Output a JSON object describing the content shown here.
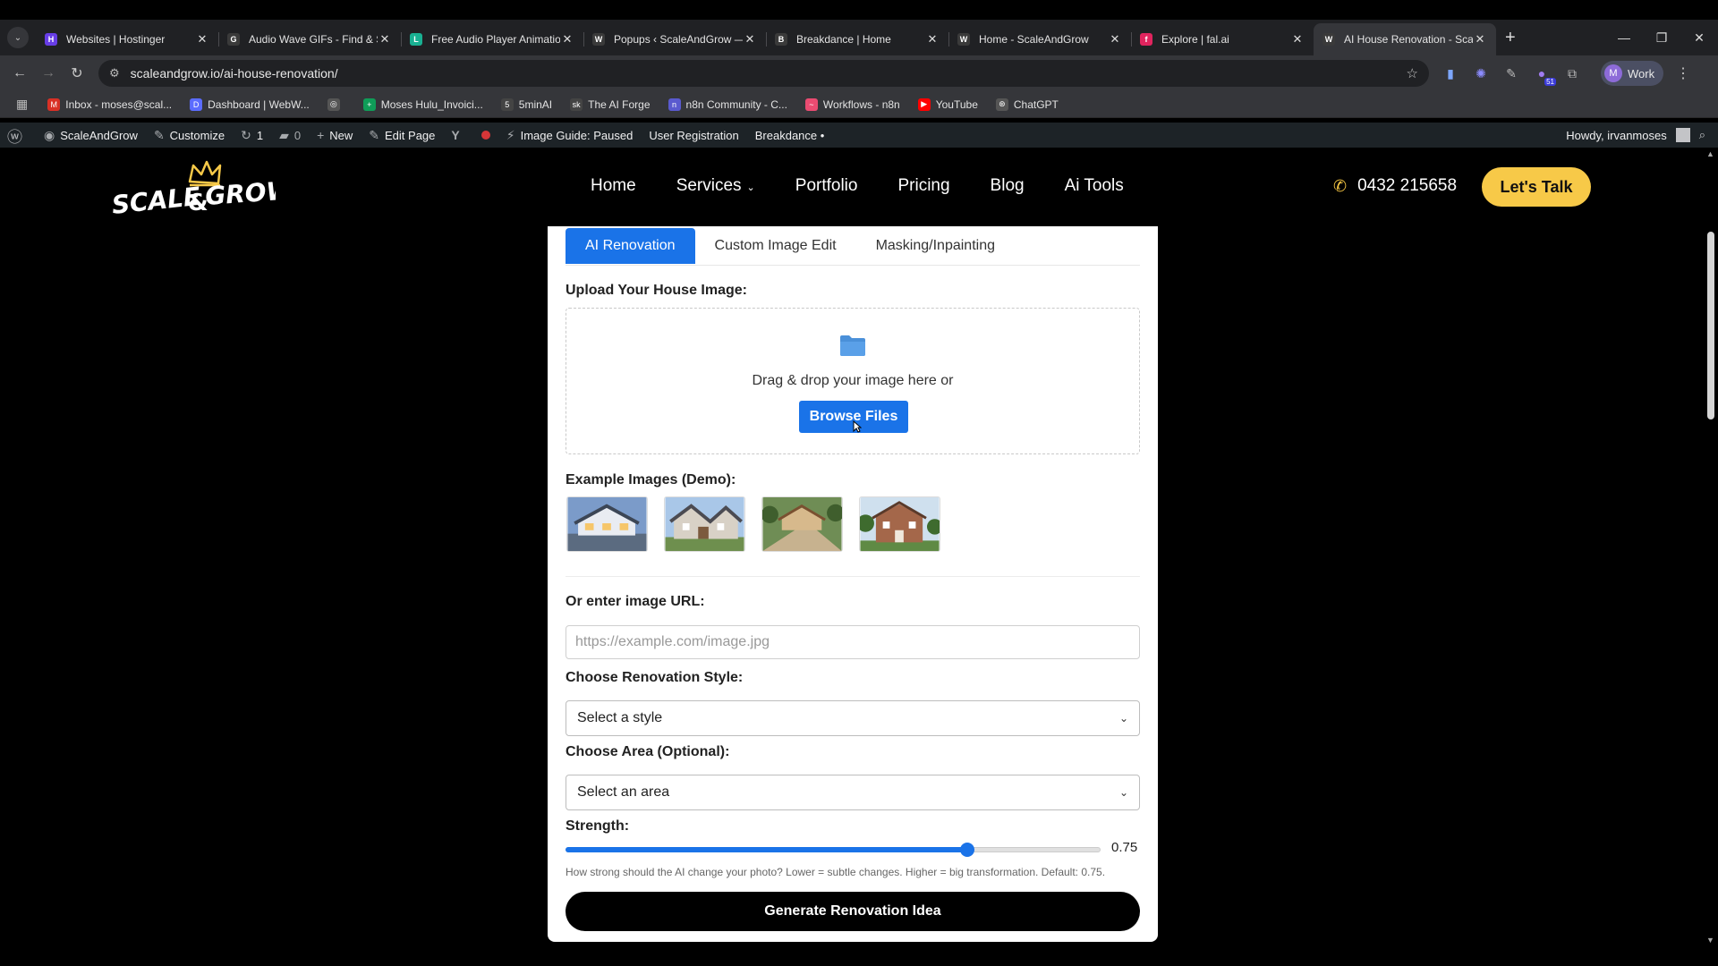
{
  "browser": {
    "tabs": [
      {
        "title": "Websites | Hostinger",
        "favicon_color": "#673de6",
        "favicon": "H"
      },
      {
        "title": "Audio Wave GIFs - Find & S",
        "favicon_color": "#3a3a3a",
        "favicon": "G"
      },
      {
        "title": "Free Audio Player Animatio",
        "favicon_color": "#19b092",
        "favicon": "L"
      },
      {
        "title": "Popups ‹ ScaleAndGrow —",
        "favicon_color": "#3a3a3a",
        "favicon": "W"
      },
      {
        "title": "Breakdance | Home",
        "favicon_color": "#3a3a3a",
        "favicon": "B"
      },
      {
        "title": "Home - ScaleAndGrow",
        "favicon_color": "#3a3a3a",
        "favicon": "W"
      },
      {
        "title": "Explore | fal.ai",
        "favicon_color": "#e0245e",
        "favicon": "f"
      },
      {
        "title": "AI House Renovation - Scal",
        "favicon_color": "#3a3a3a",
        "favicon": "W",
        "active": true
      }
    ],
    "url": "scaleandgrow.io/ai-house-renovation/",
    "profile_initial": "M",
    "profile_label": "Work",
    "extension_badge": "51",
    "bookmarks": [
      {
        "label": "Inbox - moses@scal...",
        "color": "#d93025",
        "icon": "M"
      },
      {
        "label": "Dashboard | WebW...",
        "color": "#5b6cff",
        "icon": "D"
      },
      {
        "label": "",
        "color": "#555555",
        "icon": "◎"
      },
      {
        "label": "Moses Hulu_Invoici...",
        "color": "#0f9d58",
        "icon": "+"
      },
      {
        "label": "5minAI",
        "color": "#444444",
        "icon": "5"
      },
      {
        "label": "The AI Forge",
        "color": "#444444",
        "icon": "sk"
      },
      {
        "label": "n8n Community - C...",
        "color": "#5a5acf",
        "icon": "n"
      },
      {
        "label": "Workflows - n8n",
        "color": "#ea4b71",
        "icon": "~"
      },
      {
        "label": "YouTube",
        "color": "#ff0000",
        "icon": "▶"
      },
      {
        "label": "ChatGPT",
        "color": "#555555",
        "icon": "⊛"
      }
    ]
  },
  "wpbar": {
    "site": "ScaleAndGrow",
    "customize": "Customize",
    "updates": "1",
    "comments": "0",
    "new": "New",
    "edit_page": "Edit Page",
    "image_guide": "Image Guide: Paused",
    "user_registration": "User Registration",
    "breakdance": "Breakdance •",
    "howdy": "Howdy, irvanmoses"
  },
  "site": {
    "nav": [
      "Home",
      "Services",
      "Portfolio",
      "Pricing",
      "Blog",
      "Ai Tools"
    ],
    "phone": "0432 215658",
    "cta": "Let's Talk",
    "accent": "#f7c948"
  },
  "tool": {
    "tabs": [
      "AI Renovation",
      "Custom Image Edit",
      "Masking/Inpainting"
    ],
    "upload_label": "Upload Your House Image:",
    "drop_text": "Drag & drop your image here or",
    "browse_label": "Browse Files",
    "examples_label": "Example Images (Demo):",
    "url_label": "Or enter image URL:",
    "url_placeholder": "https://example.com/image.jpg",
    "style_label": "Choose Renovation Style:",
    "style_value": "Select a style",
    "area_label": "Choose Area (Optional):",
    "area_value": "Select an area",
    "strength_label": "Strength:",
    "strength_value": 0.75,
    "strength_display": "0.75",
    "strength_hint": "How strong should the AI change your photo? Lower = subtle changes. Higher = big transformation. Default: 0.75.",
    "generate_label": "Generate Renovation Idea",
    "primary": "#1a73e8"
  }
}
